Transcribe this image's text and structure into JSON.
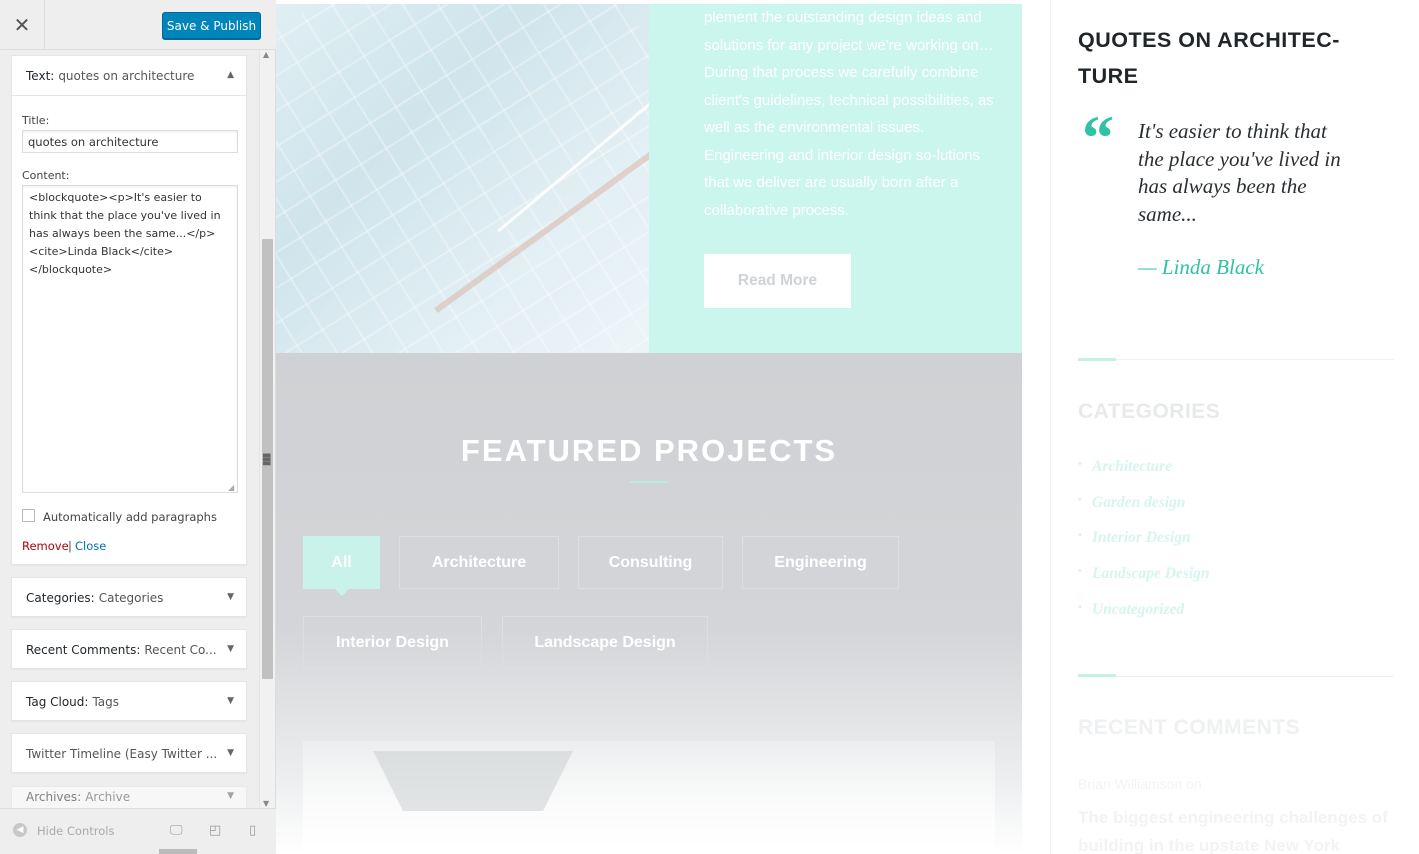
{
  "customizer": {
    "close_glyph": "✕",
    "save_label": "Save & Publish",
    "text_widget": {
      "type_label": "Text:",
      "name": "quotes on architecture",
      "title_label": "Title:",
      "title_value": "quotes on architecture",
      "content_label": "Content:",
      "content_value": "<blockquote><p>It's easier to think that the place you've lived in has always been the same...</p><cite>Linda Black</cite></blockquote>",
      "autop_label": "Automatically add paragraphs",
      "autop_checked": false,
      "remove_label": "Remove",
      "separator": "|",
      "close_label": "Close"
    },
    "widgets": [
      {
        "type_label": "Categories:",
        "name": "Categories"
      },
      {
        "type_label": "Recent Comments:",
        "name": "Recent Co..."
      },
      {
        "type_label": "Tag Cloud:",
        "name": "Tags"
      },
      {
        "type_label": "Twitter Timeline (Easy Twitter ...",
        "name": ""
      },
      {
        "type_label": "Archives:",
        "name": "Archive"
      }
    ],
    "footer": {
      "hide_label": "Hide Controls",
      "devices": [
        "desktop-icon",
        "tablet-icon",
        "mobile-icon"
      ]
    }
  },
  "preview": {
    "hero": {
      "paragraph": "plement the outstanding design ideas and solutions for any project we're working on… During that process we carefully combine client's guidelines, technical possibilities, as well as the environmental issues. Engineering and interior design so-lutions that we deliver are usually born after a collaborative process.",
      "read_more": "Read More"
    },
    "featured": {
      "title": "FEATURED PROJECTS",
      "filters": [
        "All",
        "Architecture",
        "Consulting",
        "Engineering",
        "Interior Design",
        "Landscape Design"
      ],
      "active_filter": "All"
    },
    "sidebar": {
      "quote_title": "QUOTES ON ARCHITEC-TURE",
      "quote_mark": "“",
      "quote_text": "It's easier to think that the place you've lived in has always been the same...",
      "quote_cite": "— Linda Black",
      "categories_title": "CATEGORIES",
      "categories": [
        "Architecture",
        "Garden design",
        "Interior Design",
        "Landscape Design",
        "Uncategorized"
      ],
      "recent_comments_title": "RECENT COMMENTS",
      "recent_comment_author": "Brian Williamson on",
      "recent_comment_post": "The biggest engineering challenges of building in the upstate New York"
    }
  },
  "colors": {
    "primary_button": "#0085ba",
    "accent_teal": "#2fc2a3",
    "hero_panel": "#cbf6ee",
    "remove_link": "#aa0000",
    "close_link": "#0073aa"
  }
}
